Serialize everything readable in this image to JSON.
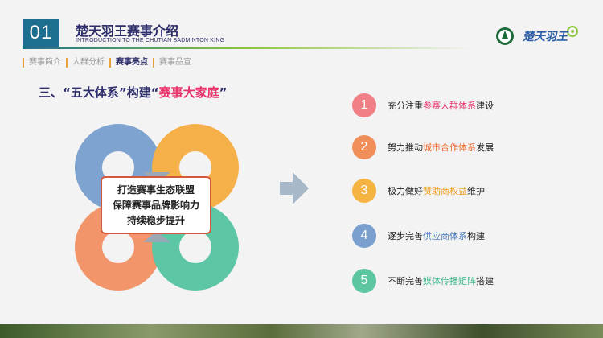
{
  "header": {
    "number": "01",
    "title": "楚天羽王赛事介绍",
    "subtitle": "INTRODUCTION TO THE CHUTIAN BADMINTON KING",
    "logo_text": "楚天羽王"
  },
  "tabs": [
    {
      "label": "赛事简介",
      "active": false
    },
    {
      "label": "人群分析",
      "active": false
    },
    {
      "label": "赛事亮点",
      "active": true
    },
    {
      "label": "赛事品宣",
      "active": false
    }
  ],
  "heading": {
    "prefix": "三、“",
    "part1": "五大体系",
    "middle": "”构建“",
    "part2": "赛事大家庭",
    "suffix": "”"
  },
  "center": {
    "line1": "打造赛事生态联盟",
    "line2": "保障赛事品牌影响力",
    "line3": "持续稳步提升"
  },
  "items": [
    {
      "num": "1",
      "before": "充分注重",
      "highlight": "参赛人群体系",
      "after": "建设",
      "color": "#f07f86",
      "hl_color": "#e8336a"
    },
    {
      "num": "2",
      "before": "努力推动",
      "highlight": "城市合作体系",
      "after": "发展",
      "color": "#f08f5a",
      "hl_color": "#ef6a2b"
    },
    {
      "num": "3",
      "before": "极力做好",
      "highlight": "赞助商权益",
      "after": "维护",
      "color": "#f5b342",
      "hl_color": "#f0a020"
    },
    {
      "num": "4",
      "before": "逐步完善",
      "highlight": "供应商体系",
      "after": "构建",
      "color": "#7b9fcf",
      "hl_color": "#4a7cc0"
    },
    {
      "num": "5",
      "before": "不断完善",
      "highlight": "媒体传播矩阵",
      "after": "搭建",
      "color": "#5cc6a0",
      "hl_color": "#3bb588"
    }
  ],
  "colors": {
    "ring_blue": "#7ea3d0",
    "ring_orange": "#f6b04a",
    "ring_salmon": "#f2956a",
    "ring_teal": "#5cc6a6",
    "accent_pink": "#e8336a"
  }
}
